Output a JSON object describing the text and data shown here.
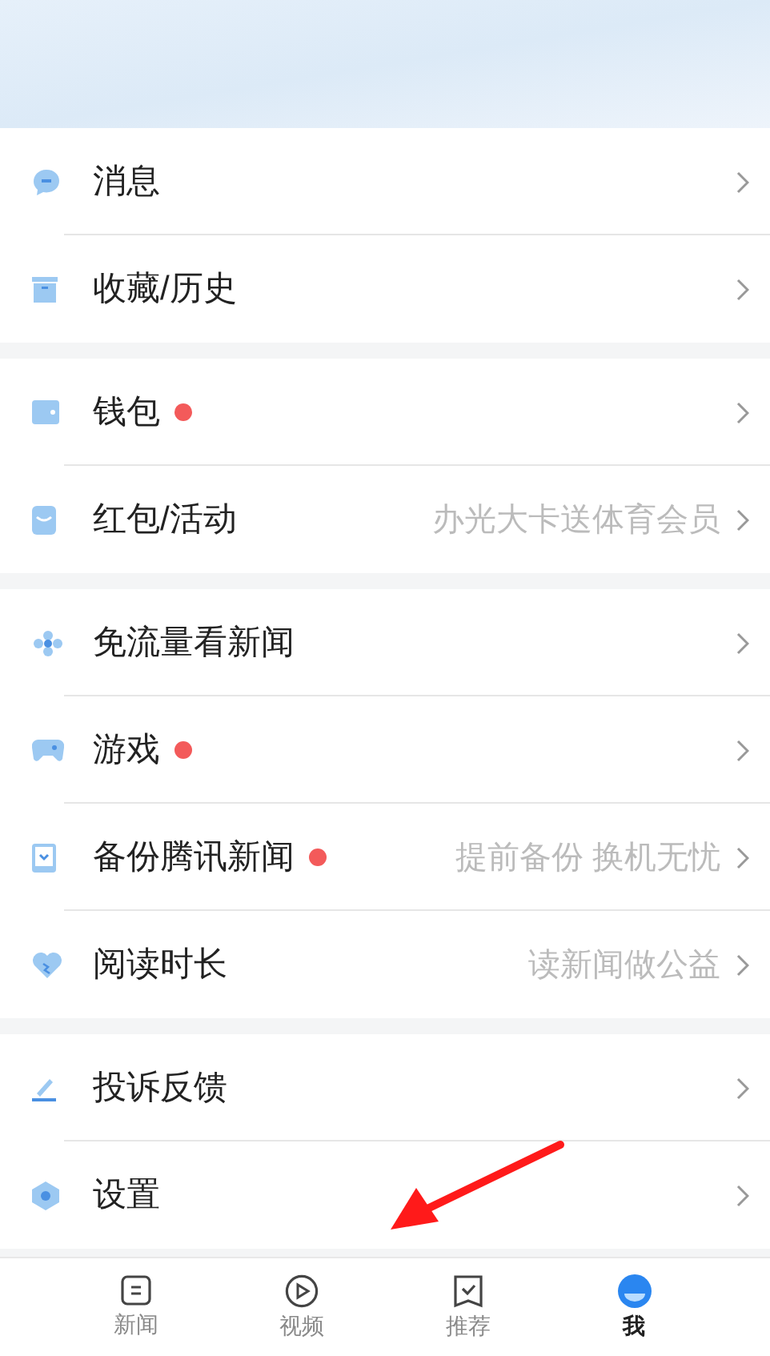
{
  "groups": [
    {
      "items": [
        {
          "title": "消息",
          "dot": false
        },
        {
          "title": "收藏/历史",
          "dot": false
        }
      ]
    },
    {
      "items": [
        {
          "title": "钱包",
          "dot": true
        },
        {
          "title": "红包/活动",
          "dot": false,
          "hint": "办光大卡送体育会员"
        }
      ]
    },
    {
      "items": [
        {
          "title": "免流量看新闻",
          "dot": false
        },
        {
          "title": "游戏",
          "dot": true
        },
        {
          "title": "备份腾讯新闻",
          "dot": true,
          "hint": "提前备份 换机无忧"
        },
        {
          "title": "阅读时长",
          "dot": false,
          "hint": "读新闻做公益"
        }
      ]
    },
    {
      "items": [
        {
          "title": "投诉反馈",
          "dot": false
        },
        {
          "title": "设置",
          "dot": false
        }
      ]
    }
  ],
  "tabs": [
    {
      "label": "新闻",
      "selected": false
    },
    {
      "label": "视频",
      "selected": false
    },
    {
      "label": "推荐",
      "selected": false
    },
    {
      "label": "我",
      "selected": true
    }
  ]
}
